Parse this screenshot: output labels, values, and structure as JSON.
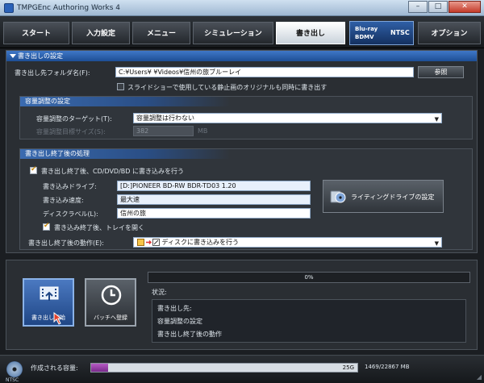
{
  "window": {
    "title": "TMPGEnc Authoring Works 4"
  },
  "nav": {
    "items": [
      "スタート",
      "入力設定",
      "メニュー",
      "シミュレーション",
      "書き出し"
    ],
    "active_index": 4,
    "badge_line1": "Blu-ray",
    "badge_line2": "BDMV",
    "badge_line3": "NTSC",
    "options": "オプション"
  },
  "output": {
    "section_title": "書き出しの設定",
    "folder_label": "書き出し先フォルダ名(F):",
    "folder_value": "C:¥Users¥            ¥Videos¥信州の旅ブルーレイ",
    "browse_button": "参照",
    "slideshow_checkbox": "スライドショーで使用している静止画のオリジナルも同時に書き出す"
  },
  "capacity": {
    "section_title": "容量調整の設定",
    "target_label": "容量調整のターゲット(T):",
    "target_value": "容量調整は行わない",
    "size_label": "容量調整目標サイズ(S):",
    "size_value": "382",
    "size_unit": "MB"
  },
  "post": {
    "section_title": "書き出し終了後の処理",
    "write_checkbox": "書き出し終了後、CD/DVD/BD に書き込みを行う",
    "drive_label": "書き込みドライブ:",
    "drive_value": "[D:]PIONEER  BD-RW   BDR-TD03 1.20",
    "speed_label": "書き込み速度:",
    "speed_value": "最大速",
    "disc_label": "ディスクラベル(L):",
    "disc_value": "信州の旅",
    "tray_checkbox": "書き込み終了後、トレイを開く",
    "drive_settings_button": "ライティングドライブの設定",
    "after_label": "書き出し終了後の動作(E):",
    "after_value": "ディスクに書き込みを行う"
  },
  "actions": {
    "start_button": "書き出し開始",
    "batch_button": "バッチへ登録",
    "progress": "0%",
    "progress_value": 0,
    "status_label": "状況:",
    "status_rows": [
      "書き出し先:",
      "容量調整の設定",
      "書き出し終了後の動作"
    ]
  },
  "footer": {
    "disc_caption": "NTSC",
    "capacity_label": "作成される容量:",
    "bar_mark": "25G",
    "capacity_value": "1469/22867 MB",
    "fill_fraction": 0.064
  }
}
